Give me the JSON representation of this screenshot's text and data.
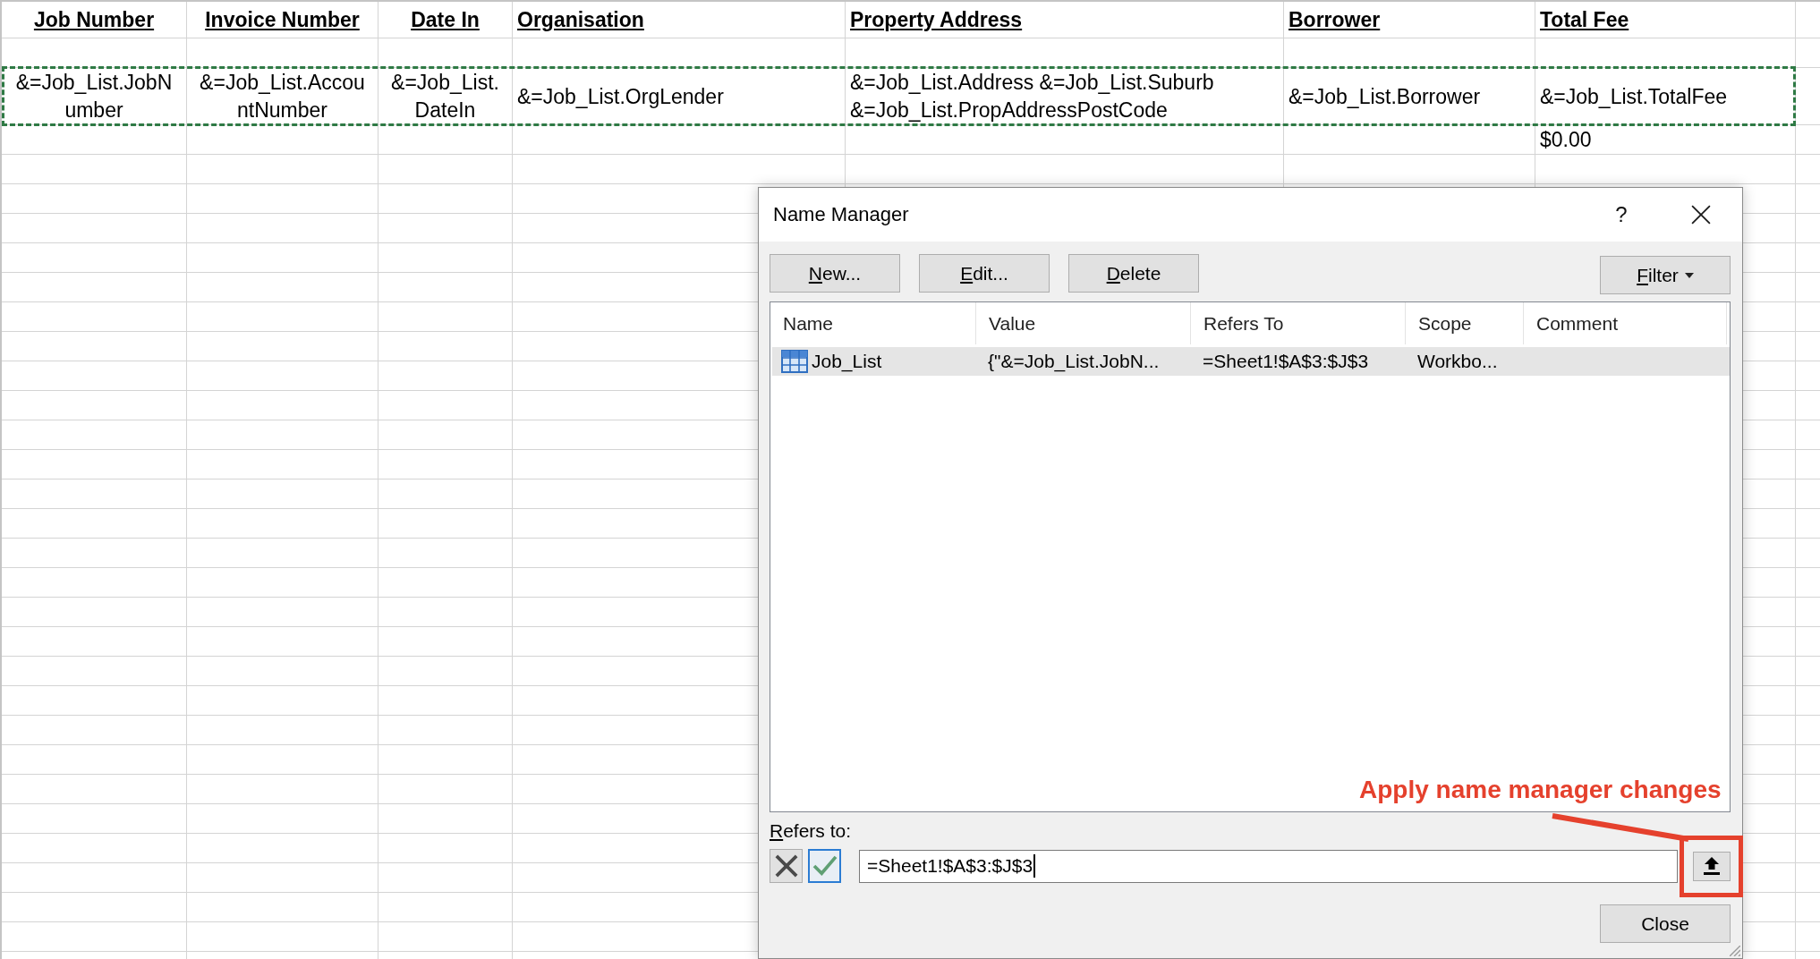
{
  "sheet": {
    "columns": [
      {
        "header": "Job Number"
      },
      {
        "header": "Invoice Number"
      },
      {
        "header": "Date In"
      },
      {
        "header": "Organisation"
      },
      {
        "header": "Property Address"
      },
      {
        "header": "Borrower"
      },
      {
        "header": "Total Fee"
      }
    ],
    "rows": [
      {
        "copied": false
      },
      {
        "copied": true,
        "cells": [
          "&=Job_List.JobNumber",
          "&=Job_List.AccountNumber",
          "&=Job_List.DateIn",
          "&=Job_List.OrgLender",
          "&=Job_List.Address &=Job_List.Suburb &=Job_List.PropAddressPostCode",
          "&=Job_List.Borrower",
          "&=Job_List.TotalFee"
        ]
      },
      {
        "copied": false,
        "cells": [
          null,
          null,
          null,
          null,
          null,
          null,
          "$0.00"
        ]
      }
    ]
  },
  "dialog": {
    "title": "Name Manager",
    "help": "?",
    "buttons": [
      {
        "label": "New...",
        "access_key": true
      },
      {
        "label": "Edit...",
        "access_key": true
      },
      {
        "label": "Delete",
        "access_key": true
      }
    ],
    "filter": {
      "label": "Filter",
      "access_key": true
    },
    "list": {
      "columns": [
        "Name",
        "Value",
        "Refers To",
        "Scope",
        "Comment"
      ],
      "rows": [
        {
          "name": "Job_List",
          "value": "{\"&=Job_List.JobN...",
          "refers_to": "=Sheet1!$A$3:$J$3",
          "scope": "Workbo...",
          "selected": true
        }
      ]
    },
    "refers_to": {
      "label": "Refers to:",
      "access_key": true,
      "value": "=Sheet1!$A$3:$J$3",
      "focused": true
    },
    "edit_buttons": [
      {
        "kind": "cancel",
        "highlighted": false
      },
      {
        "kind": "confirm",
        "highlighted": true
      }
    ],
    "close_button": {
      "label": "Close",
      "access_key": false
    }
  },
  "annotation": {
    "text": "Apply name manager changes"
  }
}
